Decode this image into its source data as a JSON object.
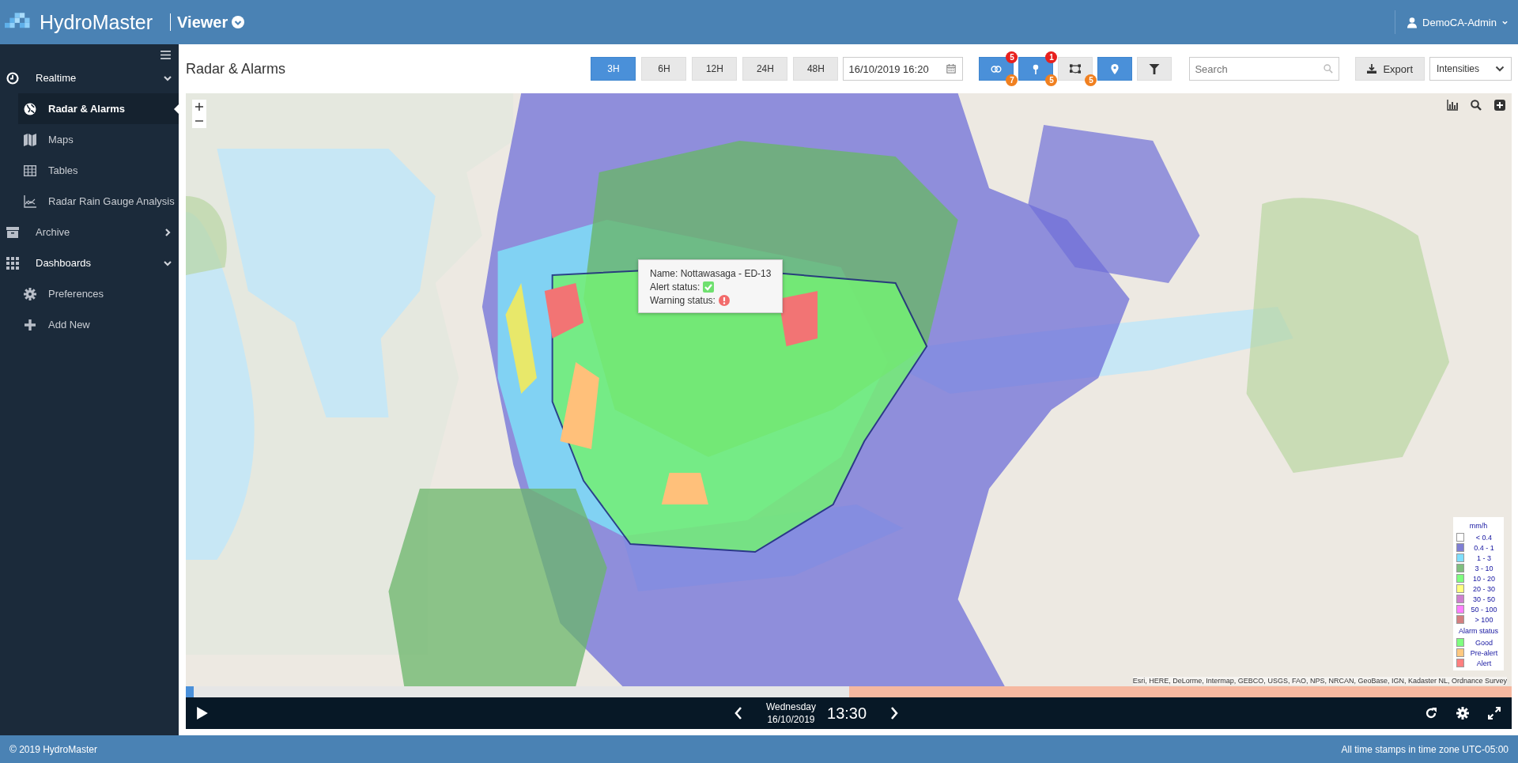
{
  "header": {
    "brand": "HydroMaster",
    "module": "Viewer",
    "user": "DemoCA-Admin"
  },
  "sidebar": {
    "items": [
      {
        "label": "Realtime",
        "expanded": true,
        "children": [
          {
            "label": "Radar & Alarms",
            "selected": true
          },
          {
            "label": "Maps",
            "selected": false
          },
          {
            "label": "Tables",
            "selected": false
          },
          {
            "label": "Radar Rain Gauge Analysis",
            "selected": false
          }
        ]
      },
      {
        "label": "Archive",
        "expanded": false
      },
      {
        "label": "Dashboards",
        "expanded": true,
        "children": [
          {
            "label": "Preferences",
            "selected": false
          },
          {
            "label": "Add New",
            "selected": false
          }
        ]
      }
    ]
  },
  "page_title": "Radar & Alarms",
  "ranges": [
    {
      "label": "3H",
      "selected": true
    },
    {
      "label": "6H",
      "selected": false
    },
    {
      "label": "12H",
      "selected": false
    },
    {
      "label": "24H",
      "selected": false
    },
    {
      "label": "48H",
      "selected": false
    }
  ],
  "date_field": {
    "value": "16/10/2019 16:20"
  },
  "layer_toggles": [
    {
      "selected": true,
      "top_badge": "5",
      "bottom_badge": "7"
    },
    {
      "selected": true,
      "top_badge": "1",
      "bottom_badge": "5"
    },
    {
      "selected": false,
      "bottom_badge": "5"
    },
    {
      "selected": true
    },
    {
      "selected": false
    }
  ],
  "search": {
    "placeholder": "Search"
  },
  "export_button": "Export",
  "view_select": {
    "value": "Intensities"
  },
  "tooltip": {
    "name": "Name: Nottawasaga - ED-13",
    "alert_label": "Alert status:",
    "alert_ok": true,
    "warning_label": "Warning status:",
    "warning_ok": false
  },
  "legend": {
    "unit": "mm/h",
    "intensity": [
      {
        "label": "< 0.4",
        "color": "#ffffff"
      },
      {
        "label": "0.4 - 1",
        "color": "#7f7fd4"
      },
      {
        "label": "1 - 3",
        "color": "#7fdfff"
      },
      {
        "label": "3 - 10",
        "color": "#7fbf7f"
      },
      {
        "label": "10 - 20",
        "color": "#7fff7f"
      },
      {
        "label": "20 - 30",
        "color": "#ffff7f"
      },
      {
        "label": "30 - 50",
        "color": "#cf7fcf"
      },
      {
        "label": "50 - 100",
        "color": "#ff7fff"
      },
      {
        "label": "> 100",
        "color": "#d47f7f"
      }
    ],
    "status_title": "Alarm status",
    "status": [
      {
        "label": "Good",
        "color": "#7fff7f"
      },
      {
        "label": "Pre-alert",
        "color": "#ffc87f"
      },
      {
        "label": "Alert",
        "color": "#ff7f7f"
      }
    ]
  },
  "attribution": "Esri, HERE, DeLorme, Intermap, GEBCO, USGS, FAO, NPS, NRCAN, GeoBase, IGN, Kadaster NL, Ordnance Survey",
  "timeline": {
    "level": 0.0,
    "day": "Wednesday",
    "date": "16/10/2019",
    "time": "13:30"
  },
  "footer": {
    "copyright": "© 2019 HydroMaster",
    "timezone": "All time stamps in time zone UTC-05:00"
  }
}
